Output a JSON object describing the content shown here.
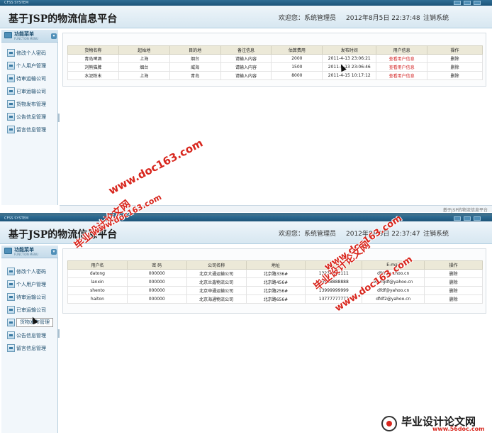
{
  "window_title": "CFSS SYSTEM",
  "site_title": "基于JSP的物流信息平台",
  "welcome": "欢迎您：系统管理员",
  "logout": "注销系统",
  "footer": "基于JSP的物流信息平台",
  "menu_head": {
    "title": "功能菜单",
    "subtitle": "FUNCTION MENU"
  },
  "menu_items": [
    "修改个人密码",
    "个人用户管理",
    "待审运输公司",
    "已审运输公司",
    "货物发布管理",
    "公告信息管理",
    "留言信息管理"
  ],
  "icons": {
    "menu": "menu-icon",
    "toggle": "chevron-down-icon",
    "window": "window-control-icon"
  },
  "screen1": {
    "datetime": "2012年8月5日  22:37:48",
    "columns": [
      "货物名称",
      "起始地",
      "目的地",
      "备注信息",
      "估算费用",
      "发布时间",
      "用户信息",
      "操作"
    ],
    "rows": [
      [
        "青岛啤酒",
        "上海",
        "烟台",
        "请输入内容",
        "2000",
        "2011-4-13 23:06:21",
        "查看用户信息",
        "删除"
      ],
      [
        "刘熊猫脾",
        "烟台",
        "威海",
        "请输入内容",
        "1500",
        "2011-4-13 23:06:46",
        "查看用户信息",
        "删除"
      ],
      [
        "水泥粉末",
        "上海",
        "青岛",
        "请输入内容",
        "8000",
        "2011-4-15 10:17:12",
        "查看用户信息",
        "删除"
      ]
    ]
  },
  "screen2": {
    "datetime": "2012年8月5日  22:37:47",
    "columns": [
      "用户名",
      "密 码",
      "公司名称",
      "地址",
      "",
      "E-mail",
      "操作"
    ],
    "rows": [
      [
        "datong",
        "000000",
        "北京大通运输公司",
        "北京路336#",
        "13211111111",
        "dfdf@yahoo.cn",
        "删除"
      ],
      [
        "lanxin",
        "000000",
        "北京兰鑫物流公司",
        "北京路456#",
        "13888888888",
        "wangdf@yahoo.cn",
        "删除"
      ],
      [
        "shento",
        "000000",
        "北京申通运输公司",
        "北京路256#",
        "13999999999",
        "dfdf@yahoo.cn",
        "删除"
      ],
      [
        "haiton",
        "000000",
        "北京海通物流公司",
        "北京路656#",
        "13777777777",
        "dfdf2@yahoo.cn",
        "删除"
      ]
    ]
  },
  "watermarks": {
    "doc163": "www.doc163.com",
    "cn_name": "毕业设计论文网",
    "url_56doc": "www.56doc.com"
  }
}
